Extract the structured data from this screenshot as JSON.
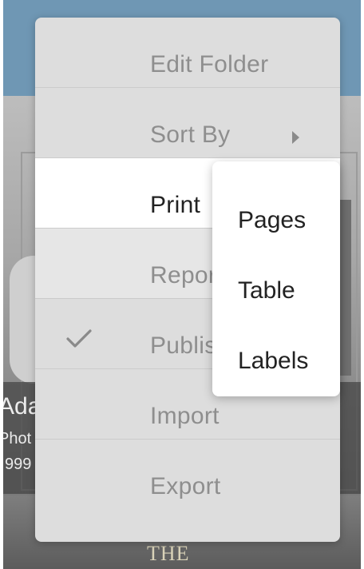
{
  "background": {
    "caption_name": "Ada",
    "caption_sub": "Phot",
    "caption_year": "999",
    "book_title": "THE"
  },
  "menu": {
    "items": [
      {
        "label": "Edit Folder"
      },
      {
        "label": "Sort By"
      },
      {
        "label": "Print"
      },
      {
        "label": "Repor"
      },
      {
        "label": "Publis"
      },
      {
        "label": "Import"
      },
      {
        "label": "Export"
      }
    ]
  },
  "submenu": {
    "items": [
      {
        "label": "Pages"
      },
      {
        "label": "Table"
      },
      {
        "label": "Labels"
      }
    ]
  },
  "icons": {
    "check": "check-icon",
    "submenu_arrow": "chevron-right-icon"
  },
  "colors": {
    "header": "#6f97b4",
    "menu_bg": "#dddddd",
    "submenu_bg": "#ffffff",
    "disabled_text": "#8e8e8e",
    "active_text": "#222222"
  }
}
